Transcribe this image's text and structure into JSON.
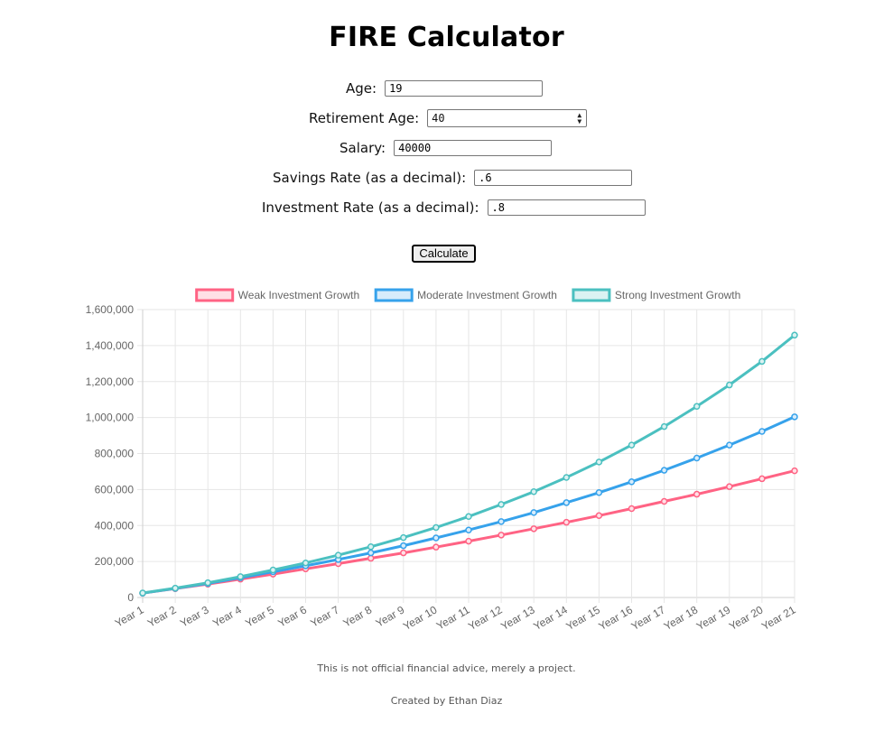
{
  "page": {
    "title": "FIRE Calculator"
  },
  "form": {
    "age_label": "Age:",
    "age_value": "19",
    "retirement_age_label": "Retirement Age:",
    "retirement_age_value": "40",
    "salary_label": "Salary:",
    "salary_value": "40000",
    "savings_rate_label": "Savings Rate (as a decimal):",
    "savings_rate_value": ".6",
    "investment_rate_label": "Investment Rate (as a decimal):",
    "investment_rate_value": ".8",
    "calculate_label": "Calculate"
  },
  "chart_data": {
    "type": "line",
    "x": [
      "Year 1",
      "Year 2",
      "Year 3",
      "Year 4",
      "Year 5",
      "Year 6",
      "Year 7",
      "Year 8",
      "Year 9",
      "Year 10",
      "Year 11",
      "Year 12",
      "Year 13",
      "Year 14",
      "Year 15",
      "Year 16",
      "Year 17",
      "Year 18",
      "Year 19",
      "Year 20",
      "Year 21"
    ],
    "ylim": [
      0,
      1600000
    ],
    "yticks": [
      "0",
      "200,000",
      "400,000",
      "600,000",
      "800,000",
      "1,000,000",
      "1,200,000",
      "1,400,000",
      "1,600,000"
    ],
    "grid": true,
    "legend_position": "top",
    "series": [
      {
        "name": "Weak Investment Growth",
        "color": "#ff6384",
        "fill": "#ffe0e6",
        "values": [
          24000,
          49000,
          74000,
          102000,
          130000,
          159000,
          188000,
          218000,
          248000,
          280000,
          313000,
          347000,
          382000,
          418000,
          455000,
          494000,
          534000,
          574000,
          616000,
          660000,
          704000
        ]
      },
      {
        "name": "Moderate Investment Growth",
        "color": "#36a2eb",
        "fill": "#d7ecfb",
        "values": [
          24000,
          50000,
          78000,
          110000,
          143000,
          176000,
          211000,
          248000,
          288000,
          331000,
          375000,
          422000,
          472000,
          527000,
          583000,
          643000,
          707000,
          775000,
          847000,
          923000,
          1004000
        ]
      },
      {
        "name": "Strong Investment Growth",
        "color": "#4bc0c0",
        "fill": "#dbf2f2",
        "values": [
          25000,
          52000,
          82000,
          116000,
          153000,
          192000,
          235000,
          282000,
          333000,
          389000,
          450000,
          517000,
          588000,
          667000,
          753000,
          847000,
          950000,
          1062000,
          1181000,
          1312000,
          1458000
        ]
      }
    ]
  },
  "footer": {
    "disclaimer": "This is not official financial advice, merely a project.",
    "credit": "Created by Ethan Diaz"
  }
}
